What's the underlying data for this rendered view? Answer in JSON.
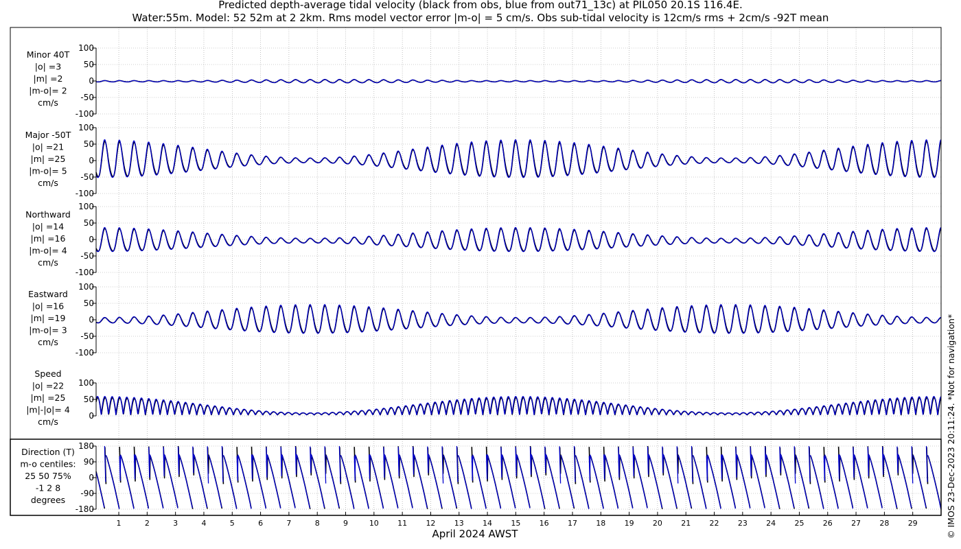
{
  "header": {
    "title_line1": "Predicted depth-average tidal velocity (black from obs, blue from out71_13c) at PIL050 20.1S 116.4E.",
    "title_line2": "Water:55m. Model: 52 52m at 2 2km. Rms model vector error |m-o| = 5 cm/s. Obs sub-tidal velocity is 12cm/s rms + 2cm/s -92T mean"
  },
  "footer": {
    "xlabel": "April 2024 AWST",
    "copyright": "© IMOS 23-Dec-2023 20:11:24. *Not for navigation*"
  },
  "colors": {
    "obs": "#000000",
    "model": "#0000cc",
    "grid": "#999999"
  },
  "chart_data": {
    "type": "line",
    "x_unit": "day of April 2024",
    "xlim": [
      0.2,
      30.0
    ],
    "x_ticks": [
      1,
      2,
      3,
      4,
      5,
      6,
      7,
      8,
      9,
      10,
      11,
      12,
      13,
      14,
      15,
      16,
      17,
      18,
      19,
      20,
      21,
      22,
      23,
      24,
      25,
      26,
      27,
      28,
      29
    ],
    "grid": true,
    "series_colors": {
      "obs": "black",
      "model": "blue"
    },
    "panels": [
      {
        "id": "minor",
        "label_lines": [
          "Minor 40T",
          "|o| =3",
          "|m| =2",
          "|m-o|= 2",
          "cm/s"
        ],
        "ylim": [
          -100,
          100
        ],
        "yticks": [
          100,
          50,
          0,
          -50,
          -100
        ],
        "tide": {
          "kind": "signed",
          "base": 3,
          "spring": 2,
          "phase": 0.4,
          "offset": -1
        }
      },
      {
        "id": "major",
        "label_lines": [
          "Major -50T",
          "|o| =21",
          "|m| =25",
          "|m-o|= 5",
          "cm/s"
        ],
        "ylim": [
          -100,
          100
        ],
        "yticks": [
          100,
          50,
          0,
          -50,
          -100
        ],
        "tide": {
          "kind": "signed",
          "base": 31,
          "spring": 24,
          "phase": 3.2,
          "offset": 0
        }
      },
      {
        "id": "northward",
        "label_lines": [
          "Northward",
          "|o| =14",
          "|m| =16",
          "|m-o|= 4",
          "cm/s"
        ],
        "ylim": [
          -100,
          100
        ],
        "yticks": [
          100,
          50,
          0,
          -50,
          -100
        ],
        "tide": {
          "kind": "signed",
          "base": 21,
          "spring": 14,
          "phase": 3.2,
          "offset": -4
        }
      },
      {
        "id": "eastward",
        "label_lines": [
          "Eastward",
          "|o| =16",
          "|m| =19",
          "|m-o|= 3",
          "cm/s"
        ],
        "ylim": [
          -100,
          100
        ],
        "yticks": [
          100,
          50,
          0,
          -50,
          -100
        ],
        "tide": {
          "kind": "signed",
          "base": 25,
          "spring": 17,
          "phase": 0.1,
          "offset": -2
        }
      },
      {
        "id": "speed",
        "label_lines": [
          "Speed",
          "|o| =22",
          "|m| =25",
          "|m|-|o|= 4",
          "cm/s"
        ],
        "ylim": [
          0,
          100
        ],
        "yticks": [
          100,
          50,
          0
        ],
        "tide": {
          "kind": "speed",
          "base": 30,
          "spring": 24,
          "phase": 3.2,
          "offset": 0
        }
      },
      {
        "id": "direction",
        "label_lines": [
          "Direction (T)",
          "m-o centiles:",
          "25  50  75%",
          "-1  2  8",
          "degrees"
        ],
        "ylim": [
          -180,
          180
        ],
        "yticks": [
          180,
          90,
          0,
          -90,
          -180
        ],
        "tide": {
          "kind": "direction"
        }
      }
    ]
  }
}
